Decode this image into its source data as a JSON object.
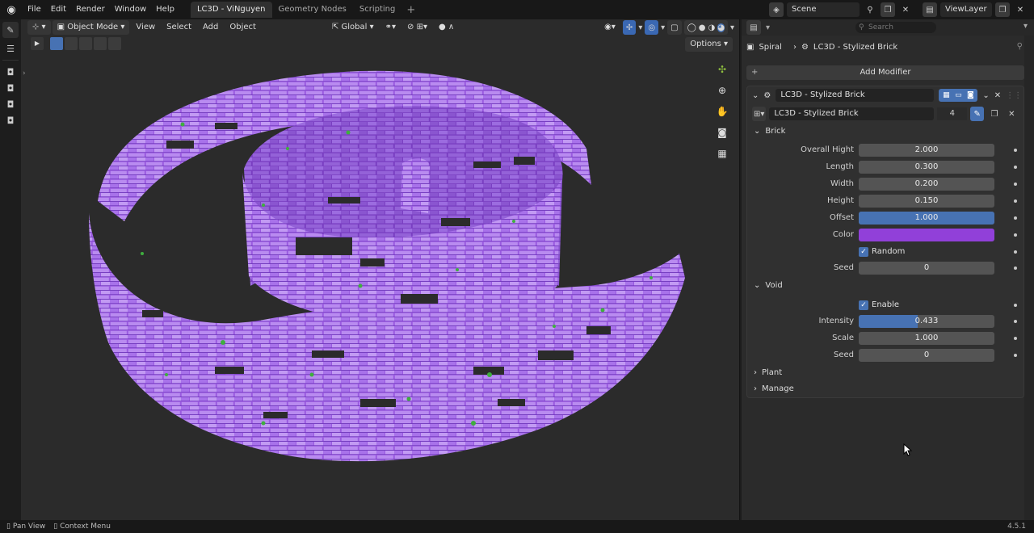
{
  "menu": {
    "items": [
      "File",
      "Edit",
      "Render",
      "Window",
      "Help"
    ]
  },
  "workspace_tabs": [
    {
      "label": "LC3D - ViNguyen",
      "active": true
    },
    {
      "label": "Geometry Nodes",
      "active": false
    },
    {
      "label": "Scripting",
      "active": false
    }
  ],
  "top_right": {
    "scene": "Scene",
    "view_layer": "ViewLayer"
  },
  "viewport": {
    "mode": "Object Mode",
    "menus": [
      "View",
      "Select",
      "Add",
      "Object"
    ],
    "transform_orientation": "Global",
    "options_label": "Options"
  },
  "properties": {
    "search_placeholder": "Search",
    "breadcrumb_object": "Spiral",
    "breadcrumb_modifier": "LC3D - Stylized Brick",
    "add_modifier_label": "Add Modifier",
    "modifier_name": "LC3D - Stylized Brick",
    "node_group_name": "LC3D - Stylized Brick",
    "node_group_users": "4",
    "brick": {
      "title": "Brick",
      "overall_hight_label": "Overall Hight",
      "overall_hight": "2.000",
      "length_label": "Length",
      "length": "0.300",
      "width_label": "Width",
      "width": "0.200",
      "height_label": "Height",
      "height": "0.150",
      "offset_label": "Offset",
      "offset": "1.000",
      "offset_fill": 1.0,
      "color_label": "Color",
      "color": "#9140d9",
      "random_label": "Random",
      "random_checked": true,
      "seed_label": "Seed",
      "seed": "0"
    },
    "void": {
      "title": "Void",
      "enable_label": "Enable",
      "enable_checked": true,
      "intensity_label": "Intensity",
      "intensity": "0.433",
      "intensity_fill": 0.433,
      "scale_label": "Scale",
      "scale": "1.000",
      "seed_label": "Seed",
      "seed": "0"
    },
    "plant_title": "Plant",
    "manage_title": "Manage"
  },
  "status": {
    "pan": "Pan View",
    "context": "Context Menu",
    "version": "4.5.1"
  },
  "colors": {
    "accent": "#4772b3",
    "brick_purple": "#9140d9",
    "moss": "#3fae3f"
  }
}
